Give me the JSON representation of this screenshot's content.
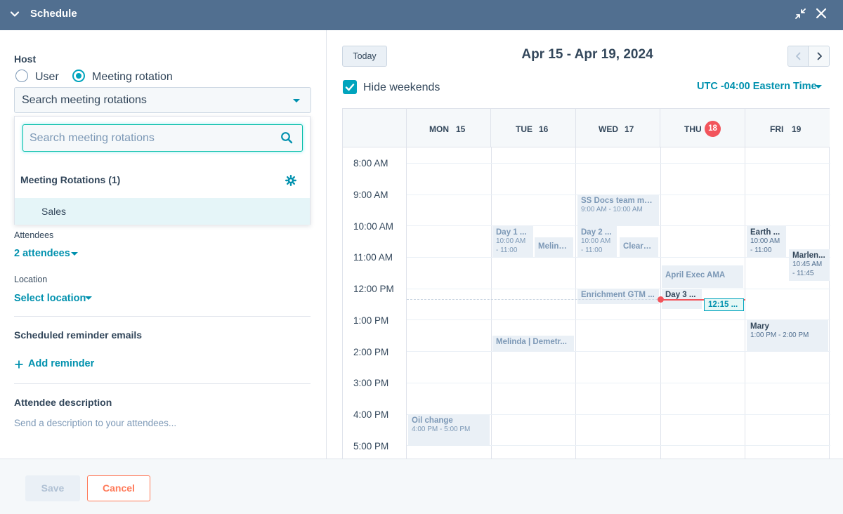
{
  "header": {
    "title": "Schedule",
    "collapse_icon": "chevron-down-icon",
    "expand_icon": "compress-icon",
    "close_icon": "close-icon",
    "bg_color": "#516f90"
  },
  "host": {
    "label": "Host",
    "option_user": "User",
    "option_rotation": "Meeting rotation",
    "selected": "Meeting rotation",
    "select_value": "Search meeting rotations"
  },
  "dropdown": {
    "search_placeholder": "Search meeting rotations",
    "group_label": "Meeting Rotations (1)",
    "items": [
      "Sales"
    ]
  },
  "attendees": {
    "label": "Attendees",
    "value": "2 attendees"
  },
  "location": {
    "label": "Location",
    "value": "Select location"
  },
  "reminders": {
    "label": "Scheduled reminder emails",
    "add_label": "Add reminder"
  },
  "description": {
    "label": "Attendee description",
    "placeholder": "Send a description to your attendees..."
  },
  "footer": {
    "save_label": "Save",
    "cancel_label": "Cancel"
  },
  "calendar": {
    "today_label": "Today",
    "range": "Apr 15 - Apr 19, 2024",
    "hide_weekends_label": "Hide weekends",
    "hide_weekends_checked": true,
    "timezone": "UTC -04:00 Eastern Time",
    "days": [
      {
        "name": "MON",
        "num": "15",
        "today": false
      },
      {
        "name": "TUE",
        "num": "16",
        "today": false
      },
      {
        "name": "WED",
        "num": "17",
        "today": false
      },
      {
        "name": "THU",
        "num": "18",
        "today": true
      },
      {
        "name": "FRI",
        "num": "19",
        "today": false
      }
    ],
    "times": [
      "8:00 AM",
      "9:00 AM",
      "10:00 AM",
      "11:00 AM",
      "12:00 PM",
      "1:00 PM",
      "2:00 PM",
      "3:00 PM",
      "4:00 PM",
      "5:00 PM"
    ],
    "events": {
      "ss_docs": {
        "title": "SS Docs team me...",
        "time": "9:00 AM - 10:00 AM"
      },
      "day1": {
        "title": "Day 1 ...",
        "time_a": "10:00 AM",
        "time_b": "- 11:00"
      },
      "melinda_short": {
        "title": "Melind..."
      },
      "day2": {
        "title": "Day 2 ...",
        "time_a": "10:00 AM",
        "time_b": "- 11:00"
      },
      "clearb": {
        "title": "Clearb..."
      },
      "earth": {
        "title": "Earth ...",
        "time_a": "10:00 AM",
        "time_b": "- 11:00"
      },
      "marlen": {
        "title": "Marlen...",
        "time_a": "10:45 AM",
        "time_b": "- 11:45"
      },
      "april_exec": {
        "title": "April Exec AMA"
      },
      "enrichment": {
        "title": "Enrichment GTM ..."
      },
      "day3": {
        "title": "Day 3 ..."
      },
      "now_event": {
        "title": "12:15 ..."
      },
      "mary": {
        "title": "Mary",
        "time": "1:00 PM - 2:00 PM"
      },
      "melinda_long": {
        "title": "Melinda | Demetr..."
      },
      "oil": {
        "title": "Oil change",
        "time": "4:00 PM - 5:00 PM"
      }
    },
    "accent_color": "#0091ae",
    "today_color": "#f2545b"
  }
}
